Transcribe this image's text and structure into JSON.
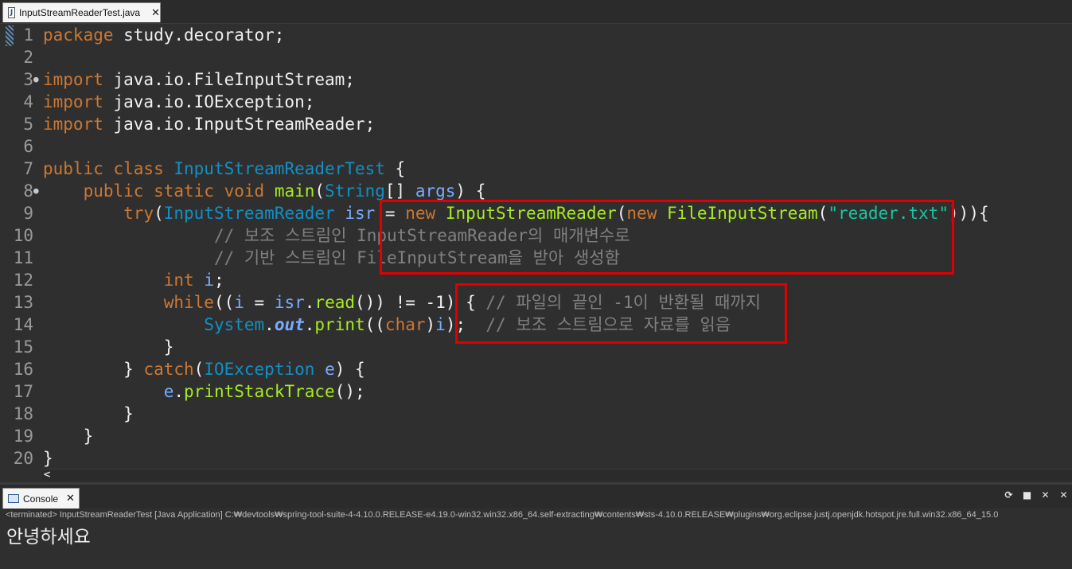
{
  "editor_tab": {
    "filename": "InputStreamReaderTest.java",
    "file_icon_label": "J",
    "close_glyph": "✕"
  },
  "code": {
    "line_numbers": [
      "1",
      "2",
      "3",
      "4",
      "5",
      "6",
      "7",
      "8",
      "9",
      "10",
      "11",
      "12",
      "13",
      "14",
      "15",
      "16",
      "17",
      "18",
      "19",
      "20"
    ],
    "fold_marker": "●",
    "l1": {
      "kw": "package",
      "text": " study.decorator;"
    },
    "l3": {
      "kw": "import",
      "text": " java.io.FileInputStream;"
    },
    "l4": {
      "kw": "import",
      "text": " java.io.IOException;"
    },
    "l5": {
      "kw": "import",
      "text": " java.io.InputStreamReader;"
    },
    "l7": {
      "kw": "public class",
      "sp": " ",
      "ty": "InputStreamReaderTest",
      "text": " {"
    },
    "l8": {
      "indent": "    ",
      "kw1": "public static void",
      "sp": " ",
      "mt": "main",
      "p1": "(",
      "ty": "String",
      "p2": "[] ",
      "vr": "args",
      "p3": ") {"
    },
    "l9": {
      "indent": "        ",
      "kw": "try",
      "p1": "(",
      "ty": "InputStreamReader",
      "sp": " ",
      "vr": "isr",
      "eq": " = ",
      "kw2": "new",
      "sp2": " ",
      "mt1": "InputStreamReader",
      "p2": "(",
      "kw3": "new",
      "sp3": " ",
      "mt2": "FileInputStream",
      "p3": "(",
      "str": "\"reader.txt\"",
      "p4": "))){"
    },
    "l10": {
      "indent": "                 ",
      "cm": "// 보조 스트림인 InputStreamReader의 매개변수로"
    },
    "l11": {
      "indent": "                 ",
      "cm": "// 기반 스트림인 FileInputStream을 받아 생성함"
    },
    "l12": {
      "indent": "            ",
      "kw": "int",
      "sp": " ",
      "vr": "i",
      "text": ";"
    },
    "l13": {
      "indent": "            ",
      "kw": "while",
      "p1": "((",
      "vr1": "i",
      "p2": " = ",
      "vr2": "isr",
      "p3": ".",
      "mt": "read",
      "p4": "()) != -1) { ",
      "cm": "// 파일의 끝인 -1이 반환될 때까지"
    },
    "l14": {
      "indent": "                ",
      "ty": "System",
      "p1": ".",
      "st": "out",
      "p2": ".",
      "mt": "print",
      "p3": "((",
      "kw": "char",
      "p4": ")",
      "vr": "i",
      "p5": ");  ",
      "cm": "// 보조 스트림으로 자료를 읽음"
    },
    "l15": {
      "indent": "            ",
      "text": "}"
    },
    "l16": {
      "indent": "        ",
      "p1": "} ",
      "kw": "catch",
      "p2": "(",
      "ty": "IOException",
      "sp": " ",
      "vr": "e",
      "p3": ") {"
    },
    "l17": {
      "indent": "            ",
      "vr": "e",
      "p1": ".",
      "mt": "printStackTrace",
      "p2": "();"
    },
    "l18": {
      "indent": "        ",
      "text": "}"
    },
    "l19": {
      "indent": "    ",
      "text": "}"
    },
    "l20": {
      "text": "}"
    }
  },
  "hscroll": {
    "arrow": "<"
  },
  "console": {
    "tab_label": "Console",
    "close_glyph": "✕",
    "tools": {
      "relaunch": "⟳",
      "terminate": "■",
      "remove": "✕",
      "remove_all": "✕"
    },
    "terminated_line": "<terminated> InputStreamReaderTest [Java Application] C:₩devtools₩spring-tool-suite-4-4.10.0.RELEASE-e4.19.0-win32.win32.x86_64.self-extracting₩contents₩sts-4.10.0.RELEASE₩plugins₩org.eclipse.justj.openjdk.hotspot.jre.full.win32.x86_64_15.0",
    "output": "안녕하세요"
  },
  "colors": {
    "keyword": "#cc7832",
    "type": "#1290c3",
    "method": "#a7ec21",
    "variable": "#79abff",
    "string": "#17c6a3",
    "comment": "#808080",
    "highlight_box": "#e00000",
    "background": "#2f2f2f"
  }
}
